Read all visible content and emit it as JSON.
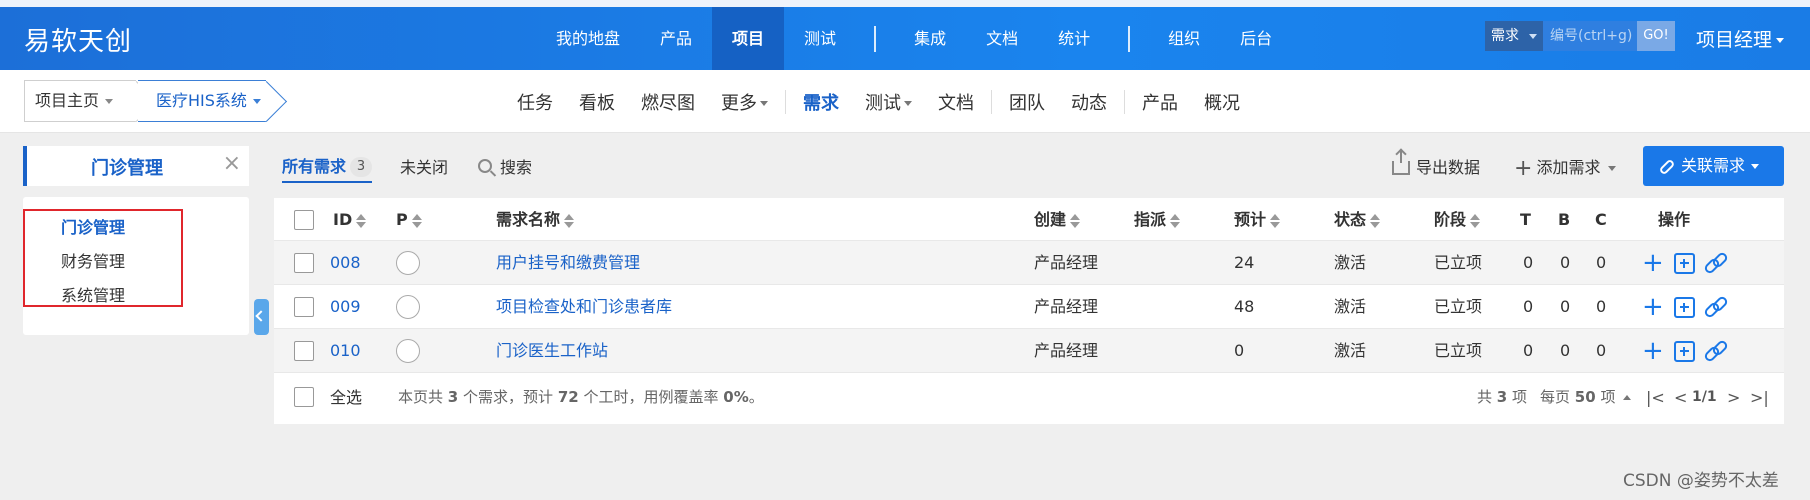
{
  "topbar": {
    "brand": "易软天创",
    "nav": [
      "我的地盘",
      "产品",
      "项目",
      "测试",
      "集成",
      "文档",
      "统计",
      "组织",
      "后台"
    ],
    "active_nav": "项目",
    "search_type": "需求",
    "search_placeholder": "编号(ctrl+g)",
    "search_go": "GO!",
    "user": "项目经理",
    "accent_color": "#1a78e8"
  },
  "subbar": {
    "crumb_home": "项目主页",
    "crumb_project": "医疗HIS系统",
    "nav": [
      "任务",
      "看板",
      "燃尽图",
      "更多",
      "需求",
      "测试",
      "文档",
      "团队",
      "动态",
      "产品",
      "概况"
    ],
    "active_nav": "需求"
  },
  "sidebar": {
    "title": "门诊管理",
    "close": "×",
    "items": [
      "门诊管理",
      "财务管理",
      "系统管理"
    ],
    "active_item": "门诊管理"
  },
  "toolbar": {
    "all_label": "所有需求",
    "all_count": "3",
    "unclosed": "未关闭",
    "search": "搜索",
    "export": "导出数据",
    "add": "添加需求",
    "link": "关联需求"
  },
  "table": {
    "columns": [
      "ID",
      "P",
      "需求名称",
      "创建",
      "指派",
      "预计",
      "状态",
      "阶段",
      "T",
      "B",
      "C",
      "操作"
    ],
    "rows": [
      {
        "id": "008",
        "name": "用户挂号和缴费管理",
        "creator": "产品经理",
        "estimate": "24",
        "status": "激活",
        "stage": "已立项",
        "t": "0",
        "b": "0",
        "c": "0"
      },
      {
        "id": "009",
        "name": "项目检查处和门诊患者库",
        "creator": "产品经理",
        "estimate": "48",
        "status": "激活",
        "stage": "已立项",
        "t": "0",
        "b": "0",
        "c": "0"
      },
      {
        "id": "010",
        "name": "门诊医生工作站",
        "creator": "产品经理",
        "estimate": "0",
        "status": "激活",
        "stage": "已立项",
        "t": "0",
        "b": "0",
        "c": "0"
      }
    ],
    "footer": {
      "select_all": "全选",
      "summary_pre": "本页共",
      "summary_count": "3",
      "summary_mid": "个需求，预计",
      "summary_hours": "72",
      "summary_post": "个工时，用例覆盖率",
      "summary_rate": "0%",
      "summary_end": "。",
      "total_pre": "共",
      "total": "3",
      "total_post": "项",
      "per_page_pre": "每页",
      "per_page": "50",
      "per_page_post": "项",
      "page": "1/1"
    }
  },
  "watermark": "CSDN @姿势不太差"
}
